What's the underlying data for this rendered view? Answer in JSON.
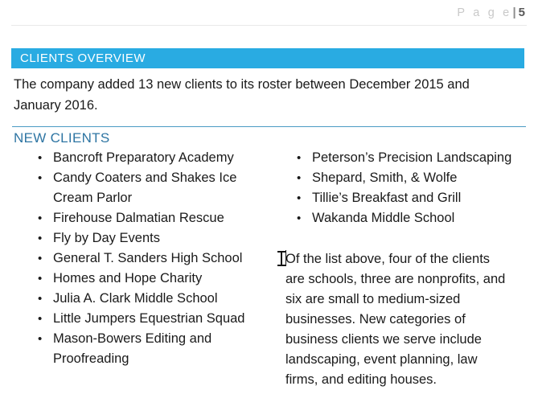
{
  "header": {
    "page_word": "P a g e",
    "separator": "|",
    "page_number": "5"
  },
  "banner": {
    "title": "CLIENTS OVERVIEW",
    "color": "#29ABE2"
  },
  "intro": {
    "text": "The company added 13 new clients to its roster between December 2015 and January 2016."
  },
  "section": {
    "title": "NEW CLIENTS",
    "color": "#2E75A3"
  },
  "clients": {
    "left_column": [
      "Bancroft Preparatory Academy",
      "Candy Coaters and Shakes Ice Cream Parlor",
      "Firehouse Dalmatian Rescue",
      "Fly by Day Events",
      "General T. Sanders High School",
      "Homes and Hope Charity",
      "Julia A. Clark Middle School",
      "Little Jumpers Equestrian Squad",
      "Mason-Bowers Editing and Proofreading"
    ],
    "right_column": [
      "Peterson’s Precision Landscaping",
      "Shepard, Smith, & Wolfe",
      "Tillie’s Breakfast and Grill",
      "Wakanda Middle School"
    ],
    "bullet_glyph": "•"
  },
  "summary": {
    "text": "Of the list above, four of the clients are schools, three are nonprofits, and six are small to medium-sized businesses. New categories of business clients we serve include landscaping, event planning, law firms, and editing houses."
  }
}
